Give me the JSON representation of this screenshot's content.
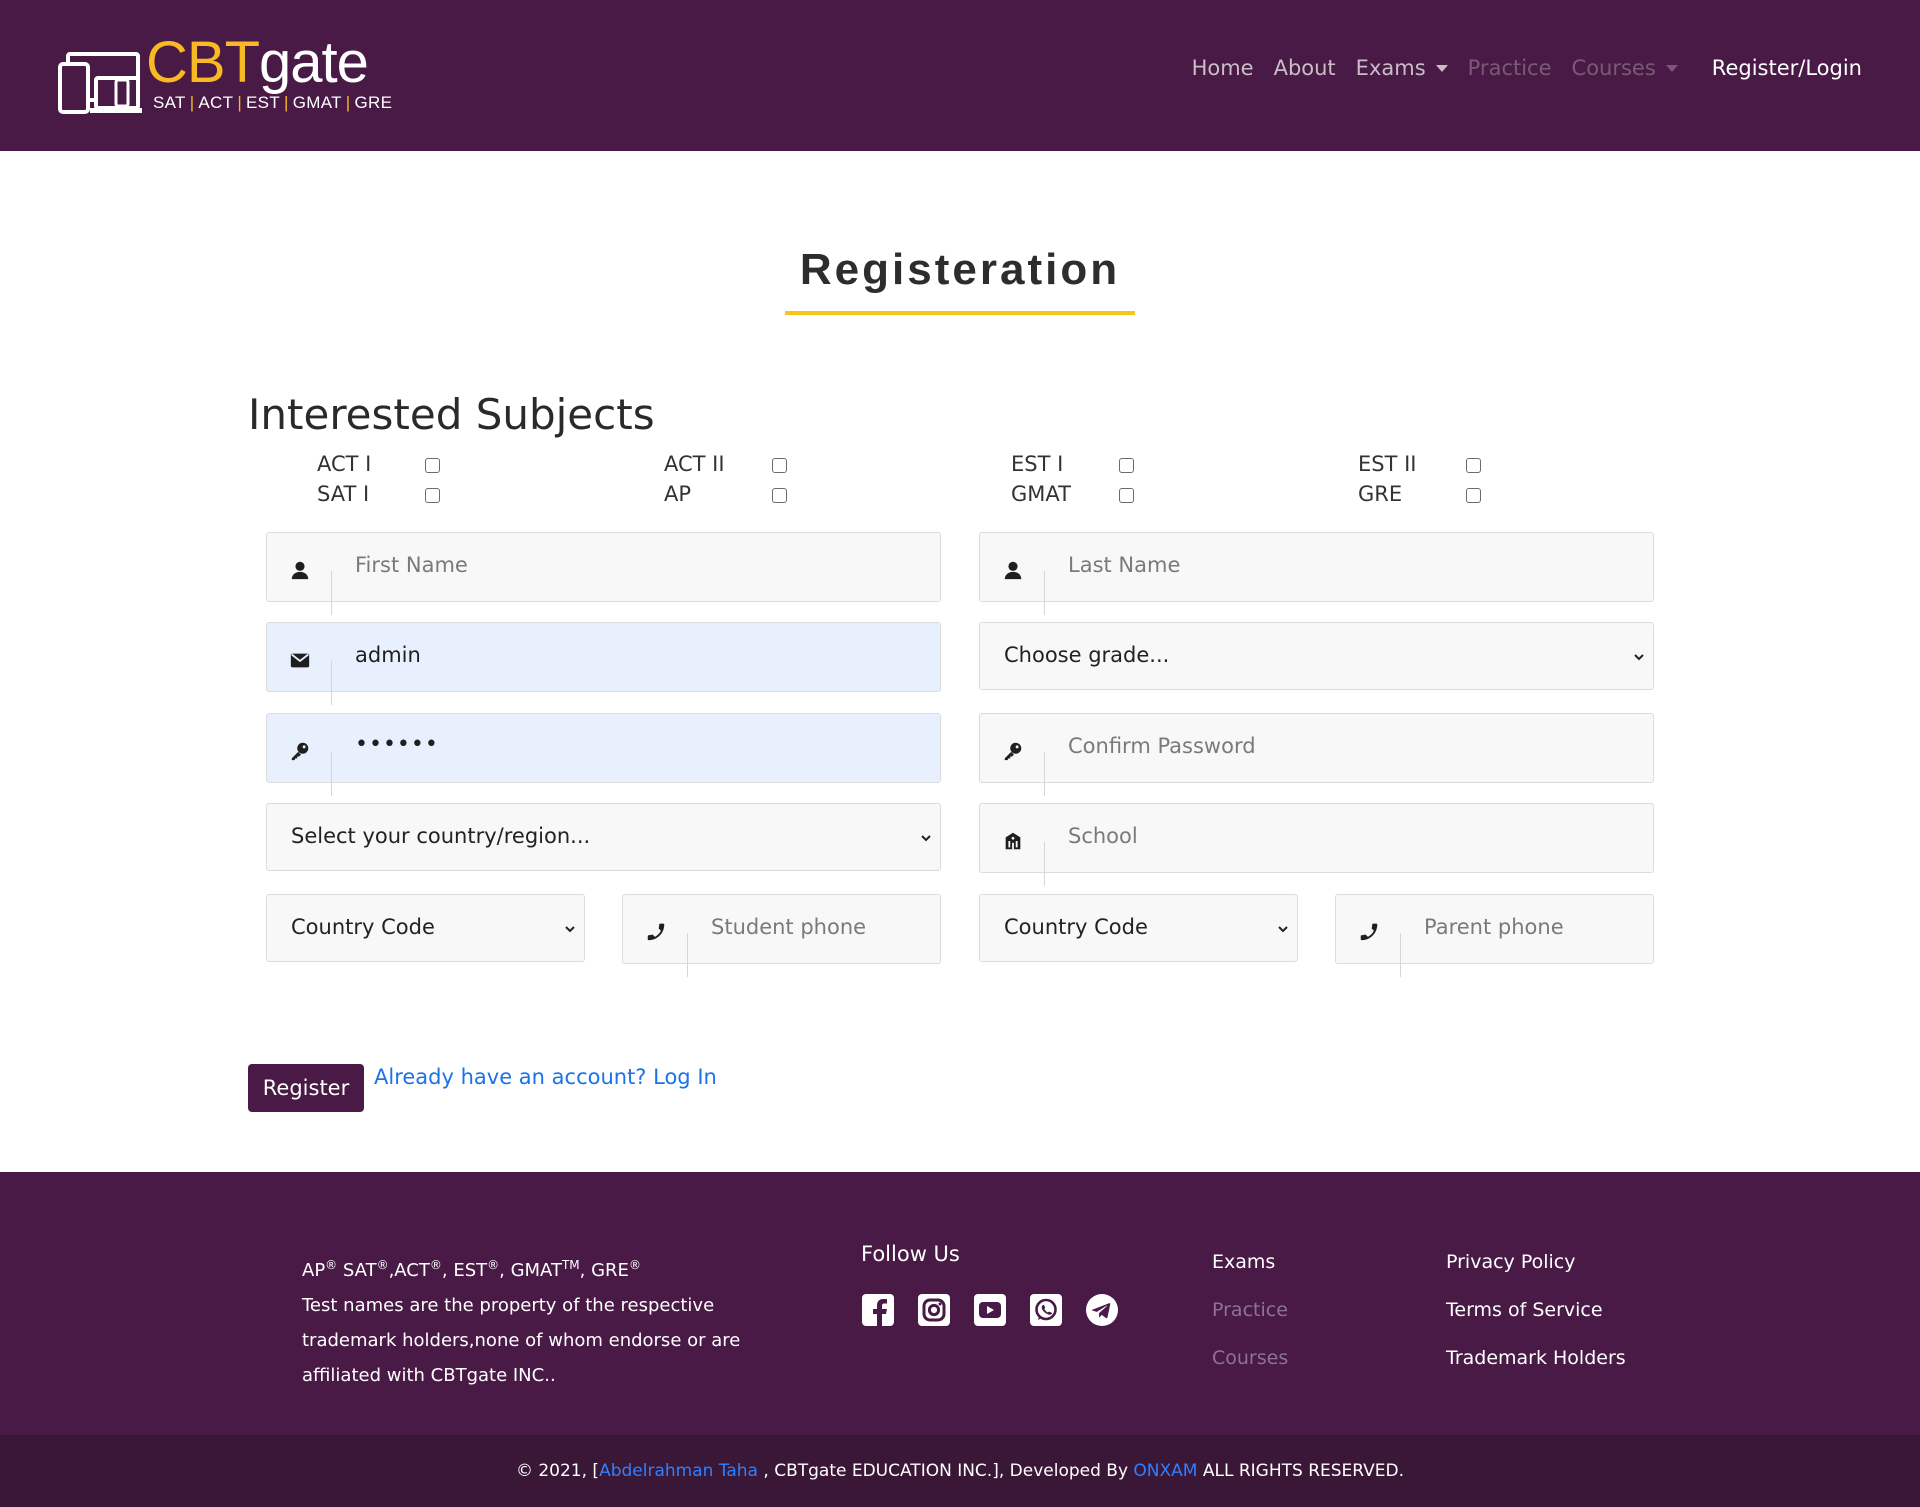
{
  "brand": {
    "name_part1": "CBT",
    "name_part2": "gate",
    "tagline": [
      "SAT",
      "ACT",
      "EST",
      "GMAT",
      "GRE"
    ],
    "accent": "#f8b923",
    "primary": "#481a45"
  },
  "nav": {
    "home": "Home",
    "about": "About",
    "exams": "Exams",
    "practice": "Practice",
    "courses": "Courses",
    "register_login": "Register/Login"
  },
  "page": {
    "title": "Registeration",
    "subjects_heading": "Interested Subjects",
    "subjects": [
      "ACT I",
      "ACT II",
      "EST I",
      "EST II",
      "SAT I",
      "AP",
      "GMAT",
      "GRE"
    ]
  },
  "form": {
    "first_name_placeholder": "First Name",
    "last_name_placeholder": "Last Name",
    "email_value": "admin",
    "grade_selected": "Choose grade...",
    "password_value": "••••••",
    "confirm_password_placeholder": "Confirm Password",
    "country_selected": "Select your country/region...",
    "school_placeholder": "School",
    "student_country_code": "Country Code",
    "student_phone_placeholder": "Student phone",
    "parent_country_code": "Country Code",
    "parent_phone_placeholder": "Parent phone",
    "register_button": "Register",
    "login_link": "Already have an account? Log In"
  },
  "footer": {
    "trademark_line1_parts": [
      "AP",
      "SAT",
      ",ACT",
      ", EST",
      ", GMAT",
      ", GRE"
    ],
    "trademark_marks": [
      "®",
      "®",
      "®",
      "®",
      "TM",
      "®"
    ],
    "trademark_text": [
      "Test names are the property of the respective",
      "trademark holders,none of whom endorse or are",
      "affiliated with CBTgate INC.."
    ],
    "follow_us": "Follow Us",
    "social_icons": [
      "facebook-icon",
      "instagram-icon",
      "youtube-icon",
      "whatsapp-icon",
      "telegram-icon"
    ],
    "links_col1": [
      "Exams",
      "Practice",
      "Courses"
    ],
    "links_col2": [
      "Privacy Policy",
      "Terms of Service",
      "Trademark Holders"
    ],
    "copyright_prefix": "© 2021, [",
    "author": "Abdelrahman Taha",
    "copyright_mid": " , CBTgate EDUCATION INC.], Developed By ",
    "developer": "ONXAM",
    "copyright_suffix": " ALL RIGHTS RESERVED."
  }
}
